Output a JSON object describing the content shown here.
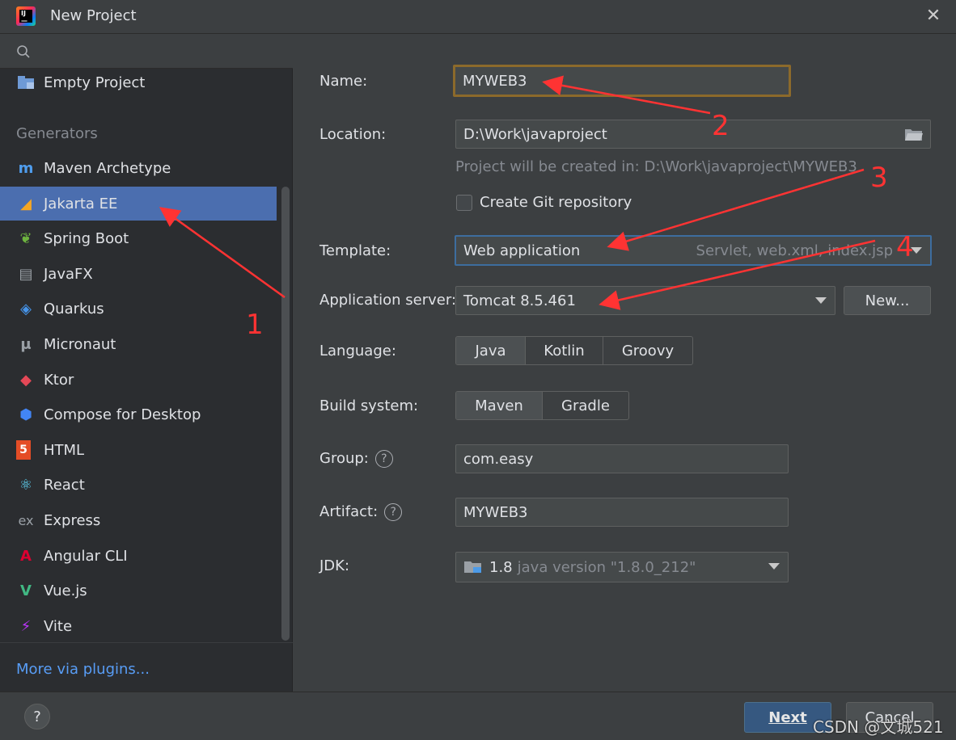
{
  "window": {
    "title": "New Project"
  },
  "sidebar": {
    "search_placeholder": "",
    "top_item": {
      "label": "Empty Project",
      "icon": "folder-icon"
    },
    "section_label": "Generators",
    "items": [
      {
        "label": "Maven Archetype",
        "icon": "maven-icon",
        "color": "#4f9ded"
      },
      {
        "label": "Jakarta EE",
        "icon": "jakarta-icon",
        "color": "#f5a623"
      },
      {
        "label": "Spring Boot",
        "icon": "spring-icon",
        "color": "#6db33f"
      },
      {
        "label": "JavaFX",
        "icon": "javafx-icon",
        "color": "#9aa0a6"
      },
      {
        "label": "Quarkus",
        "icon": "quarkus-icon",
        "color": "#4695eb"
      },
      {
        "label": "Micronaut",
        "icon": "micronaut-icon",
        "color": "#9aa0a6"
      },
      {
        "label": "Ktor",
        "icon": "ktor-icon",
        "color": "#e44857"
      },
      {
        "label": "Compose for Desktop",
        "icon": "compose-icon",
        "color": "#4285f4"
      },
      {
        "label": "HTML",
        "icon": "html5-icon",
        "color": "#e44d26"
      },
      {
        "label": "React",
        "icon": "react-icon",
        "color": "#61dafb"
      },
      {
        "label": "Express",
        "icon": "express-icon",
        "color": "#9aa0a6"
      },
      {
        "label": "Angular CLI",
        "icon": "angular-icon",
        "color": "#dd0031"
      },
      {
        "label": "Vue.js",
        "icon": "vue-icon",
        "color": "#41b883"
      },
      {
        "label": "Vite",
        "icon": "vite-icon",
        "color": "#bd34fe"
      }
    ],
    "selected": "Jakarta EE",
    "plugins_link": "More via plugins..."
  },
  "form": {
    "name": {
      "label": "Name:",
      "value": "MYWEB3"
    },
    "location": {
      "label": "Location:",
      "value": "D:\\Work\\javaproject"
    },
    "location_hint": "Project will be created in: D:\\Work\\javaproject\\MYWEB3",
    "git_checkbox": {
      "label": "Create Git repository",
      "checked": false
    },
    "template": {
      "label": "Template:",
      "value": "Web application",
      "hint": "Servlet, web.xml, index.jsp"
    },
    "app_server": {
      "label": "Application server:",
      "value": "Tomcat 8.5.461",
      "new_button": "New..."
    },
    "language": {
      "label": "Language:",
      "options": [
        "Java",
        "Kotlin",
        "Groovy"
      ],
      "selected": "Java"
    },
    "build_system": {
      "label": "Build system:",
      "options": [
        "Maven",
        "Gradle"
      ],
      "selected": "Maven"
    },
    "group": {
      "label": "Group:",
      "value": "com.easy"
    },
    "artifact": {
      "label": "Artifact:",
      "value": "MYWEB3"
    },
    "jdk": {
      "label": "JDK:",
      "version": "1.8",
      "detail": "java version \"1.8.0_212\""
    }
  },
  "footer": {
    "help": "?",
    "next": "Next",
    "cancel": "Cancel"
  },
  "watermark": "CSDN @文城521",
  "annotations": [
    "1",
    "2",
    "3",
    "4"
  ]
}
